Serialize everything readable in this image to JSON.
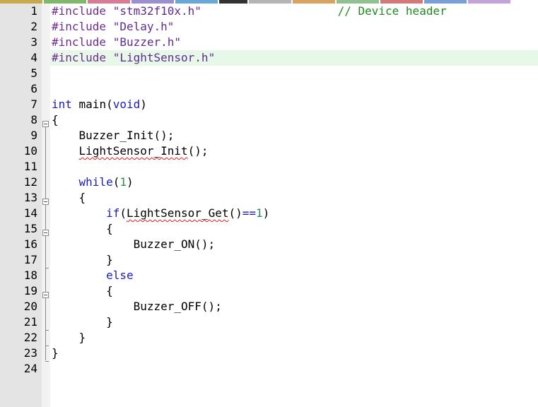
{
  "tabs_colors": [
    "#c9a94d",
    "#7fb86a",
    "#d87b94",
    "#9b8fd1",
    "#6aa7d6",
    "#333333",
    "#b5b5b5",
    "#d9a25f",
    "#8fc28f",
    "#d47979",
    "#7a9ed9",
    "#c4a3d9"
  ],
  "lines": [
    {
      "n": "1",
      "tokens": [
        {
          "c": "pp",
          "t": "#include "
        },
        {
          "c": "str",
          "t": "\"stm32f10x.h\""
        },
        {
          "c": "",
          "t": "                    "
        },
        {
          "c": "cmt",
          "t": "// Device header"
        }
      ]
    },
    {
      "n": "2",
      "tokens": [
        {
          "c": "pp",
          "t": "#include "
        },
        {
          "c": "str",
          "t": "\"Delay.h\""
        }
      ]
    },
    {
      "n": "3",
      "tokens": [
        {
          "c": "pp",
          "t": "#include "
        },
        {
          "c": "str",
          "t": "\"Buzzer.h\""
        }
      ]
    },
    {
      "n": "4",
      "current": true,
      "tokens": [
        {
          "c": "pp",
          "t": "#include "
        },
        {
          "c": "str",
          "t": "\"LightSensor.h\""
        }
      ]
    },
    {
      "n": "5",
      "tokens": []
    },
    {
      "n": "6",
      "tokens": []
    },
    {
      "n": "7",
      "tokens": [
        {
          "c": "kw",
          "t": "int"
        },
        {
          "c": "",
          "t": " main("
        },
        {
          "c": "kw",
          "t": "void"
        },
        {
          "c": "",
          "t": ")"
        }
      ]
    },
    {
      "n": "8",
      "tokens": [
        {
          "c": "",
          "t": "{"
        }
      ]
    },
    {
      "n": "9",
      "tokens": [
        {
          "c": "",
          "t": "    Buzzer_Init();"
        }
      ]
    },
    {
      "n": "10",
      "tokens": [
        {
          "c": "",
          "t": "    "
        },
        {
          "c": "err",
          "t": "LightSensor_Init"
        },
        {
          "c": "",
          "t": "();"
        }
      ]
    },
    {
      "n": "11",
      "tokens": []
    },
    {
      "n": "12",
      "tokens": [
        {
          "c": "",
          "t": "    "
        },
        {
          "c": "kw",
          "t": "while"
        },
        {
          "c": "",
          "t": "("
        },
        {
          "c": "num",
          "t": "1"
        },
        {
          "c": "",
          "t": ")"
        }
      ]
    },
    {
      "n": "13",
      "tokens": [
        {
          "c": "",
          "t": "    {"
        }
      ]
    },
    {
      "n": "14",
      "tokens": [
        {
          "c": "",
          "t": "        "
        },
        {
          "c": "kw",
          "t": "if"
        },
        {
          "c": "",
          "t": "("
        },
        {
          "c": "err",
          "t": "LightSensor_Get"
        },
        {
          "c": "",
          "t": "()"
        },
        {
          "c": "op",
          "t": "=="
        },
        {
          "c": "num",
          "t": "1"
        },
        {
          "c": "",
          "t": ")"
        }
      ]
    },
    {
      "n": "15",
      "tokens": [
        {
          "c": "",
          "t": "        {"
        }
      ]
    },
    {
      "n": "16",
      "tokens": [
        {
          "c": "",
          "t": "            Buzzer_ON();"
        }
      ]
    },
    {
      "n": "17",
      "tokens": [
        {
          "c": "",
          "t": "        }"
        }
      ]
    },
    {
      "n": "18",
      "tokens": [
        {
          "c": "",
          "t": "        "
        },
        {
          "c": "kw",
          "t": "else"
        }
      ]
    },
    {
      "n": "19",
      "tokens": [
        {
          "c": "",
          "t": "        {"
        }
      ]
    },
    {
      "n": "20",
      "tokens": [
        {
          "c": "",
          "t": "            Buzzer_OFF();"
        }
      ]
    },
    {
      "n": "21",
      "tokens": [
        {
          "c": "",
          "t": "        }"
        }
      ]
    },
    {
      "n": "22",
      "tokens": [
        {
          "c": "",
          "t": "    }"
        }
      ]
    },
    {
      "n": "23",
      "tokens": [
        {
          "c": "",
          "t": "}"
        }
      ]
    },
    {
      "n": "24",
      "tokens": []
    }
  ]
}
